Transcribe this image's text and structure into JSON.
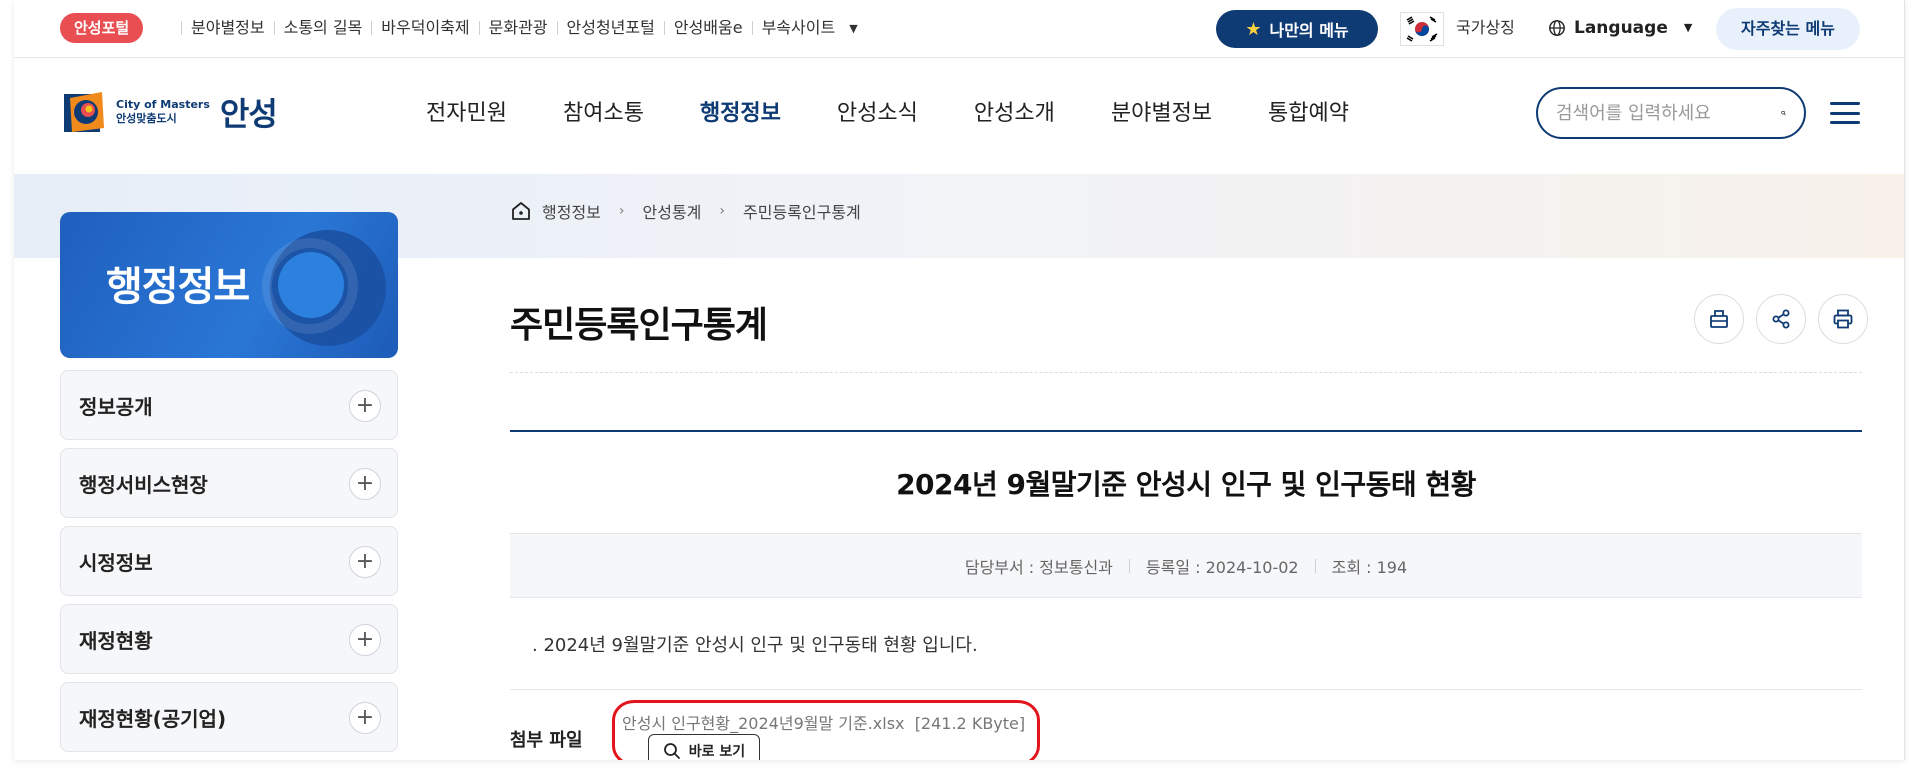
{
  "topbar": {
    "portal_badge": "안성포털",
    "links": [
      "분야별정보",
      "소통의 길목",
      "바우덕이축제",
      "문화관광",
      "안성청년포털",
      "안성배움e",
      "부속사이트"
    ],
    "my_menu": "나만의 메뉴",
    "national_symbol": "국가상징",
    "language": "Language",
    "frequent_menu": "자주찾는 메뉴"
  },
  "header": {
    "logo_en": "City of Masters",
    "logo_ko_tag": "안성맞춤도시",
    "logo_name": "안성",
    "nav": [
      "전자민원",
      "참여소통",
      "행정정보",
      "안성소식",
      "안성소개",
      "분야별정보",
      "통합예약"
    ],
    "active_nav_index": 2,
    "search_placeholder": "검색어를 입력하세요"
  },
  "sidebar": {
    "title": "행정정보",
    "items": [
      {
        "label": "정보공개"
      },
      {
        "label": "행정서비스현장"
      },
      {
        "label": "시정정보"
      },
      {
        "label": "재정현황"
      },
      {
        "label": "재정현황(공기업)"
      }
    ]
  },
  "breadcrumb": [
    "행정정보",
    "안성통계",
    "주민등록인구통계"
  ],
  "page_title": "주민등록인구통계",
  "article": {
    "title": "2024년 9월말기준 안성시 인구 및 인구동태 현황",
    "department": "담당부서 : 정보통신과",
    "date": "등록일 : 2024-10-02",
    "views": "조회 : 194",
    "body": ". 2024년 9월말기준 안성시 인구 및 인구동태 현황 입니다."
  },
  "attachment": {
    "label": "첨부 파일",
    "filename": "안성시 인구현황_2024년9월말 기준.xlsx",
    "size": "[241.2 KByte]",
    "view_button": "바로 보기"
  },
  "colors": {
    "navy": "#0f3b74",
    "portal_red": "#e94e52",
    "sidebar_blue": "#2a77d6",
    "highlight_red": "#e3141b"
  }
}
